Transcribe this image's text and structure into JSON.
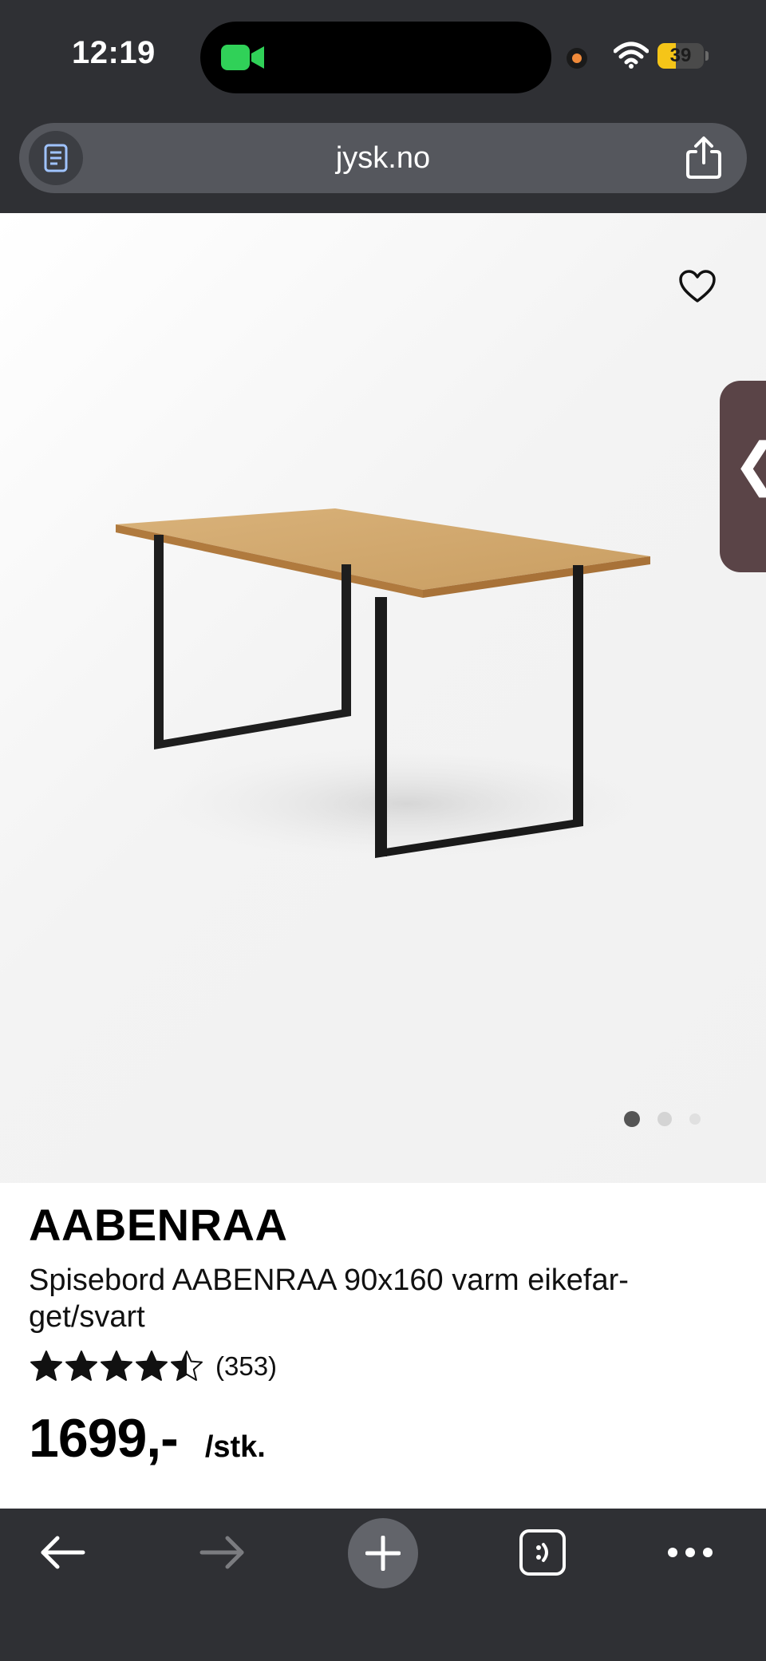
{
  "status_bar": {
    "time": "12:19",
    "battery": "39",
    "battery_level_percent": 39,
    "battery_color": "#f5c518",
    "camera_indicator_color": "#30d158",
    "recording_dot_color": "#f08a3a"
  },
  "browser": {
    "url": "jysk.no",
    "reader_icon": "reader-icon",
    "share_icon": "share-icon"
  },
  "product": {
    "brand": "AABENRAA",
    "description": "Spisebord AABENRAA 90x160 varm eikefar-get/svart",
    "rating_value": 4.5,
    "rating_max": 5,
    "review_count": "(353)",
    "price": "1699,-",
    "unit": "/stk.",
    "image_count": 3,
    "active_image_index": 0
  },
  "side_tab": {
    "label": "❮"
  },
  "toolbar": {
    "icons": [
      "back-arrow-icon",
      "forward-arrow-icon",
      "plus-icon",
      "tabs-icon",
      "more-icon"
    ]
  },
  "colors": {
    "chrome_bg": "#2f3034",
    "address_bar_bg": "#55575d",
    "side_tab_bg": "#5a4447"
  }
}
